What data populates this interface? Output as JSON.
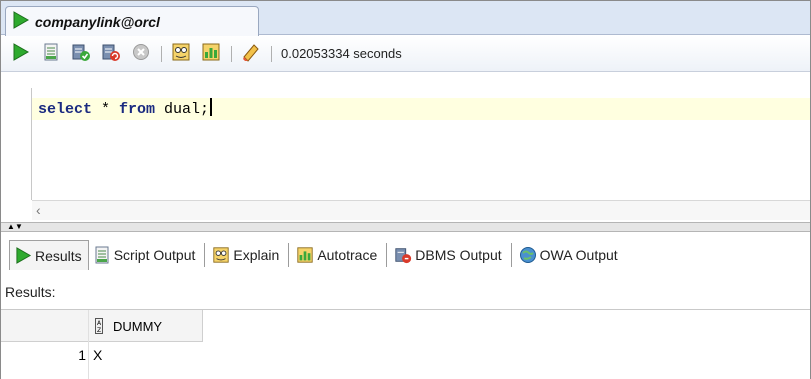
{
  "tab": {
    "title": "companylink@orcl",
    "icon": "play-arrow-icon"
  },
  "toolbar": {
    "buttons": [
      {
        "name": "run-statement-icon"
      },
      {
        "name": "run-script-icon"
      },
      {
        "name": "commit-icon"
      },
      {
        "name": "rollback-icon"
      },
      {
        "name": "cancel-icon"
      },
      {
        "name": "explain-plan-icon"
      },
      {
        "name": "autotrace-icon"
      },
      {
        "name": "clear-icon"
      }
    ],
    "timing": "0.02053334 seconds"
  },
  "editor": {
    "sql_parts": [
      "select",
      " * ",
      "from",
      " dual;"
    ]
  },
  "result_tabs": [
    {
      "label": "Results",
      "icon": "play-arrow-icon"
    },
    {
      "label": "Script Output",
      "icon": "script-output-icon"
    },
    {
      "label": "Explain",
      "icon": "explain-icon"
    },
    {
      "label": "Autotrace",
      "icon": "autotrace-icon"
    },
    {
      "label": "DBMS Output",
      "icon": "dbms-output-icon"
    },
    {
      "label": "OWA Output",
      "icon": "owa-output-icon"
    }
  ],
  "results_label": "Results:",
  "grid": {
    "columns": [
      "DUMMY"
    ],
    "rows": [
      {
        "row_number": "1",
        "values": [
          "X"
        ]
      }
    ]
  },
  "colors": {
    "accent_green": "#2eaa2e",
    "tab_strip": "#dce6f4",
    "editor_line_highlight": "#ffffe0"
  }
}
